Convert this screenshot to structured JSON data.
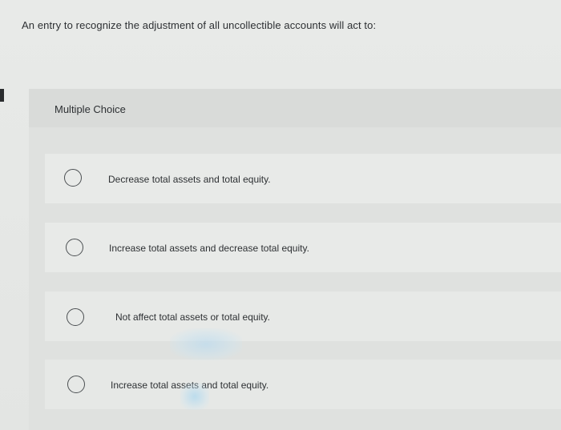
{
  "question": {
    "text": "An entry to recognize the adjustment of all uncollectible accounts will act to:"
  },
  "multiple_choice": {
    "title": "Multiple Choice",
    "options": [
      {
        "label": "Decrease total assets and total equity.",
        "selected": false
      },
      {
        "label": "Increase total assets and decrease total equity.",
        "selected": false
      },
      {
        "label": "Not affect total assets or total equity.",
        "selected": false
      },
      {
        "label": "Increase total assets and total equity.",
        "selected": false
      }
    ]
  }
}
